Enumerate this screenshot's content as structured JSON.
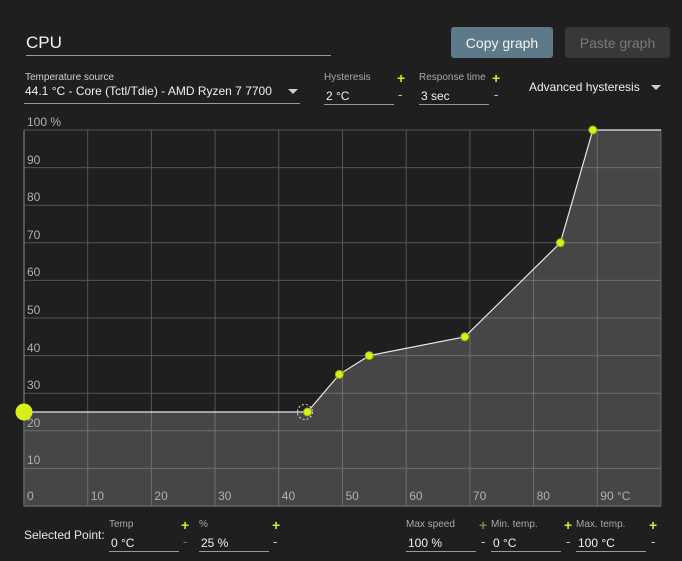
{
  "header": {
    "name_value": "CPU",
    "copy_label": "Copy graph",
    "paste_label": "Paste graph"
  },
  "controls": {
    "temp_source_label": "Temperature source",
    "temp_source_value": "44.1 °C - Core (Tctl/Tdie) - AMD Ryzen 7 7700",
    "hysteresis_label": "Hysteresis",
    "hysteresis_value": "2 °C",
    "response_label": "Response time",
    "response_value": "3 sec",
    "advanced_label": "Advanced hysteresis",
    "plus": "+",
    "minus": "-"
  },
  "chart_data": {
    "type": "line",
    "y_top_label": "100 %",
    "y_ticks": [
      "90",
      "80",
      "70",
      "60",
      "50",
      "40",
      "30",
      "20",
      "10"
    ],
    "x_ticks": [
      "0",
      "10",
      "20",
      "30",
      "40",
      "50",
      "60",
      "70",
      "80",
      "90 °C"
    ],
    "xlim": [
      0,
      100
    ],
    "ylim": [
      0,
      100
    ],
    "points": [
      {
        "x": 0,
        "y": 25
      },
      {
        "x": 44.5,
        "y": 25
      },
      {
        "x": 49.5,
        "y": 35
      },
      {
        "x": 54.2,
        "y": 40
      },
      {
        "x": 69.2,
        "y": 45
      },
      {
        "x": 84.2,
        "y": 70
      },
      {
        "x": 89.3,
        "y": 100
      },
      {
        "x": 100,
        "y": 100
      }
    ],
    "current_temp": 44.1,
    "grid": true
  },
  "footer": {
    "selected_label": "Selected Point:",
    "temp_label": "Temp",
    "temp_value": "0 °C",
    "pct_label": "%",
    "pct_value": "25 %",
    "maxspeed_label": "Max speed",
    "maxspeed_value": "100 %",
    "mintemp_label": "Min. temp.",
    "mintemp_value": "0 °C",
    "maxtemp_label": "Max. temp.",
    "maxtemp_value": "100 °C"
  },
  "colors": {
    "accent": "#d8f01a",
    "button_active": "#5e7a88",
    "fill": "#4a4a4a",
    "grid": "#6a6a6a"
  }
}
